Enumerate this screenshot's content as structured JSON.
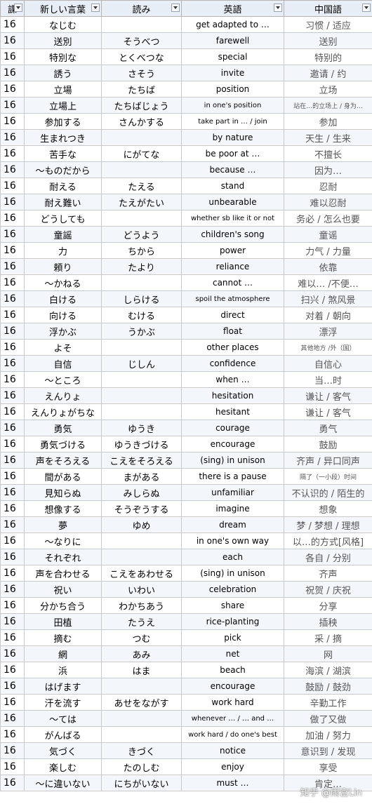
{
  "headers": {
    "level": "課",
    "word": "新しい言葉",
    "reading": "読み",
    "english": "英語",
    "chinese": "中国語"
  },
  "rows": [
    {
      "level": "16",
      "word": "なじむ",
      "reading": "",
      "english": "get adapted to …",
      "chinese": "习惯 / 适应"
    },
    {
      "level": "16",
      "word": "送別",
      "reading": "そうべつ",
      "english": "farewell",
      "chinese": "送别"
    },
    {
      "level": "16",
      "word": "特別な",
      "reading": "とくべつな",
      "english": "special",
      "chinese": "特别的"
    },
    {
      "level": "16",
      "word": "誘う",
      "reading": "さそう",
      "english": "invite",
      "chinese": "邀请 / 约"
    },
    {
      "level": "16",
      "word": "立場",
      "reading": "たちば",
      "english": "position",
      "chinese": "立场"
    },
    {
      "level": "16",
      "word": "立場上",
      "reading": "たちばじょう",
      "english": "in one's position",
      "chinese": "站在…的立场上 / 身为…"
    },
    {
      "level": "16",
      "word": "参加する",
      "reading": "さんかする",
      "english": "take part in … / join",
      "chinese": "参加"
    },
    {
      "level": "16",
      "word": "生まれつき",
      "reading": "",
      "english": "by nature",
      "chinese": "天生 / 生来"
    },
    {
      "level": "16",
      "word": "苦手な",
      "reading": "にがてな",
      "english": "be poor at …",
      "chinese": "不擅长"
    },
    {
      "level": "16",
      "word": "～ものだから",
      "reading": "",
      "english": "because …",
      "chinese": "因为…"
    },
    {
      "level": "16",
      "word": "耐える",
      "reading": "たえる",
      "english": "stand",
      "chinese": "忍耐"
    },
    {
      "level": "16",
      "word": "耐え難い",
      "reading": "たえがたい",
      "english": "unbearable",
      "chinese": "难以忍耐"
    },
    {
      "level": "16",
      "word": "どうしても",
      "reading": "",
      "english": "whether sb like it or not",
      "chinese": "务必 / 怎么也要"
    },
    {
      "level": "16",
      "word": "童謡",
      "reading": "どうよう",
      "english": "children's song",
      "chinese": "童谣"
    },
    {
      "level": "16",
      "word": "力",
      "reading": "ちから",
      "english": "power",
      "chinese": "力气 / 力量"
    },
    {
      "level": "16",
      "word": "頼り",
      "reading": "たより",
      "english": "reliance",
      "chinese": "依靠"
    },
    {
      "level": "16",
      "word": "～かねる",
      "reading": "",
      "english": "cannot …",
      "chinese": "难以… /不便…"
    },
    {
      "level": "16",
      "word": "白ける",
      "reading": "しらける",
      "english": "spoil the atmosphere",
      "chinese": "扫兴 / 煞风景"
    },
    {
      "level": "16",
      "word": "向ける",
      "reading": "むける",
      "english": "direct",
      "chinese": "对着 / 朝向"
    },
    {
      "level": "16",
      "word": "浮かぶ",
      "reading": "うかぶ",
      "english": "float",
      "chinese": "漂浮"
    },
    {
      "level": "16",
      "word": "よそ",
      "reading": "",
      "english": "other places",
      "chinese": "其他地方 /外（国）"
    },
    {
      "level": "16",
      "word": "自信",
      "reading": "じしん",
      "english": "confidence",
      "chinese": "自信心"
    },
    {
      "level": "16",
      "word": "～ところ",
      "reading": "",
      "english": "when …",
      "chinese": "当…时"
    },
    {
      "level": "16",
      "word": "えんりょ",
      "reading": "",
      "english": "hesitation",
      "chinese": "谦让 / 客气"
    },
    {
      "level": "16",
      "word": "えんりょがちな",
      "reading": "",
      "english": "hesitant",
      "chinese": "谦让 / 客气"
    },
    {
      "level": "16",
      "word": "勇気",
      "reading": "ゆうき",
      "english": "courage",
      "chinese": "勇气"
    },
    {
      "level": "16",
      "word": "勇気づける",
      "reading": "ゆうきづける",
      "english": "encourage",
      "chinese": "鼓励"
    },
    {
      "level": "16",
      "word": "声をそろえる",
      "reading": "こえをそろえる",
      "english": "(sing) in unison",
      "chinese": "齐声 / 异口同声"
    },
    {
      "level": "16",
      "word": "間がある",
      "reading": "まがある",
      "english": "there is a pause",
      "chinese": "隔了（一小段）时间"
    },
    {
      "level": "16",
      "word": "見知らぬ",
      "reading": "みしらぬ",
      "english": "unfamiliar",
      "chinese": "不认识的 / 陌生的"
    },
    {
      "level": "16",
      "word": "想像する",
      "reading": "そうぞうする",
      "english": "imagine",
      "chinese": "想象"
    },
    {
      "level": "16",
      "word": "夢",
      "reading": "ゆめ",
      "english": "dream",
      "chinese": "梦 / 梦想 / 理想"
    },
    {
      "level": "16",
      "word": "～なりに",
      "reading": "",
      "english": "in one's own way",
      "chinese": "以…的方式[风格]"
    },
    {
      "level": "16",
      "word": "それぞれ",
      "reading": "",
      "english": "each",
      "chinese": "各自 / 分别"
    },
    {
      "level": "16",
      "word": "声を合わせる",
      "reading": "こえをあわせる",
      "english": "(sing) in unison",
      "chinese": "齐声"
    },
    {
      "level": "16",
      "word": "祝い",
      "reading": "いわい",
      "english": "celebration",
      "chinese": "祝贺 / 庆祝"
    },
    {
      "level": "16",
      "word": "分かち合う",
      "reading": "わかちあう",
      "english": "share",
      "chinese": "分享"
    },
    {
      "level": "16",
      "word": "田植",
      "reading": "たうえ",
      "english": "rice-planting",
      "chinese": "插秧"
    },
    {
      "level": "16",
      "word": "摘む",
      "reading": "つむ",
      "english": "pick",
      "chinese": "采 / 摘"
    },
    {
      "level": "16",
      "word": "網",
      "reading": "あみ",
      "english": "net",
      "chinese": "网"
    },
    {
      "level": "16",
      "word": "浜",
      "reading": "はま",
      "english": "beach",
      "chinese": "海滨 / 湖滨"
    },
    {
      "level": "16",
      "word": "はげます",
      "reading": "",
      "english": "encourage",
      "chinese": "鼓励 / 鼓劲"
    },
    {
      "level": "16",
      "word": "汗を流す",
      "reading": "あせをながす",
      "english": "work hard",
      "chinese": "辛勤工作"
    },
    {
      "level": "16",
      "word": "～ては",
      "reading": "",
      "english": "whenever … / … and …",
      "chinese": "做了又做"
    },
    {
      "level": "16",
      "word": "がんばる",
      "reading": "",
      "english": "work hard / do one's best",
      "chinese": "加油 / 努力"
    },
    {
      "level": "16",
      "word": "気づく",
      "reading": "きづく",
      "english": "notice",
      "chinese": "意识到 / 发现"
    },
    {
      "level": "16",
      "word": "楽しむ",
      "reading": "たのしむ",
      "english": "enjoy",
      "chinese": "享受"
    },
    {
      "level": "16",
      "word": "～に違いない",
      "reading": "にちがいない",
      "english": "must …",
      "chinese": "肯定…"
    }
  ],
  "watermark": "知乎 @雨宫Lin"
}
